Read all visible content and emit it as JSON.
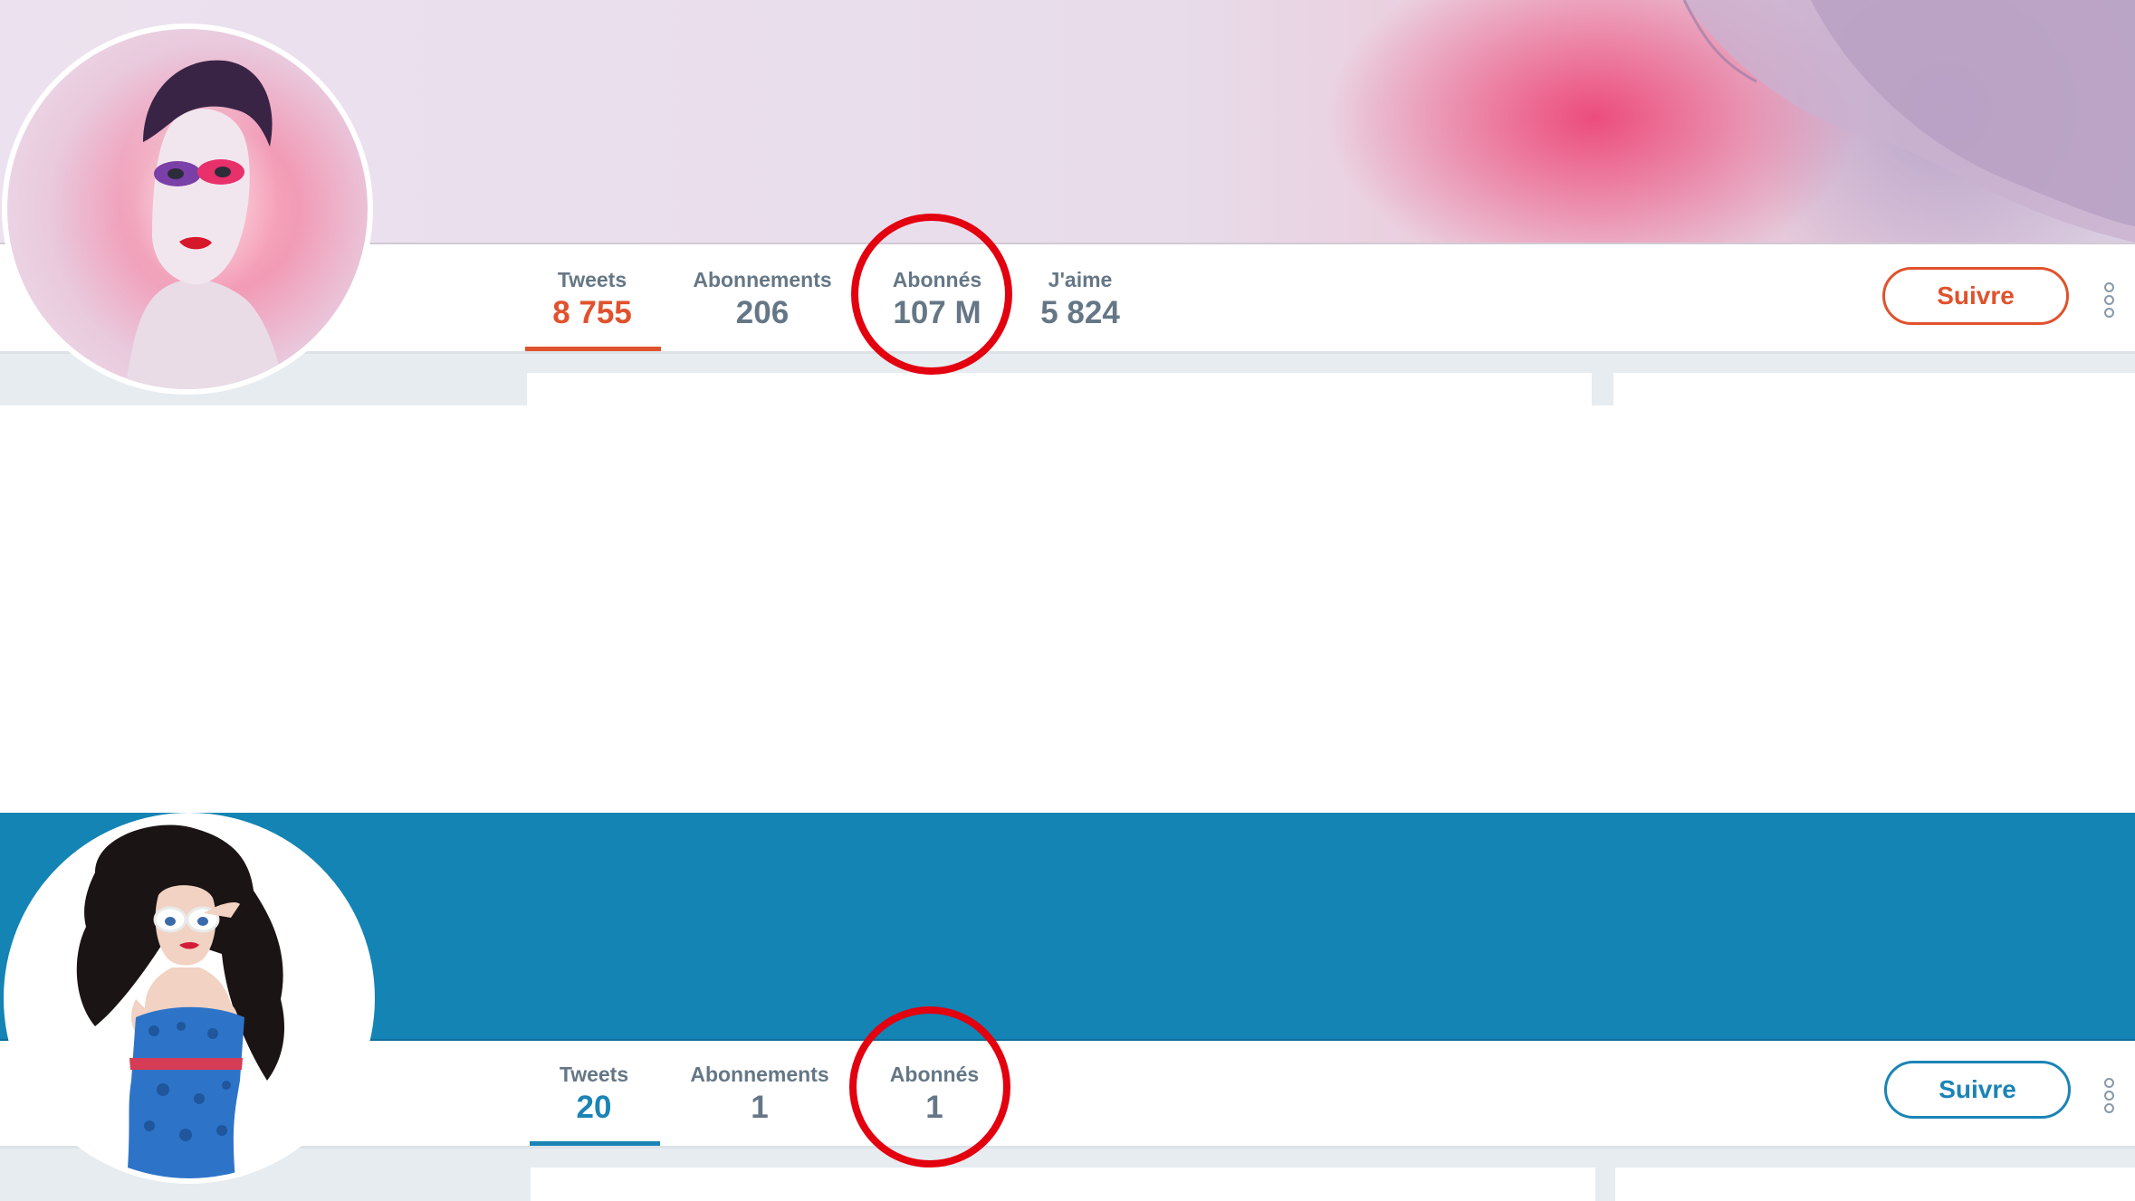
{
  "profiles": [
    {
      "stats": [
        {
          "label": "Tweets",
          "value": "8 755"
        },
        {
          "label": "Abonnements",
          "value": "206"
        },
        {
          "label": "Abonnés",
          "value": "107 M"
        },
        {
          "label": "J'aime",
          "value": "5 824"
        }
      ],
      "follow_label": "Suivre",
      "accent_color": "#e0522d",
      "banner": "pink-purple portrait photo"
    },
    {
      "stats": [
        {
          "label": "Tweets",
          "value": "20"
        },
        {
          "label": "Abonnements",
          "value": "1"
        },
        {
          "label": "Abonnés",
          "value": "1"
        }
      ],
      "follow_label": "Suivre",
      "accent_color": "#1b84b6",
      "banner": "solid blue"
    }
  ],
  "annotation": {
    "color": "#e3000f",
    "shape": "circle"
  }
}
